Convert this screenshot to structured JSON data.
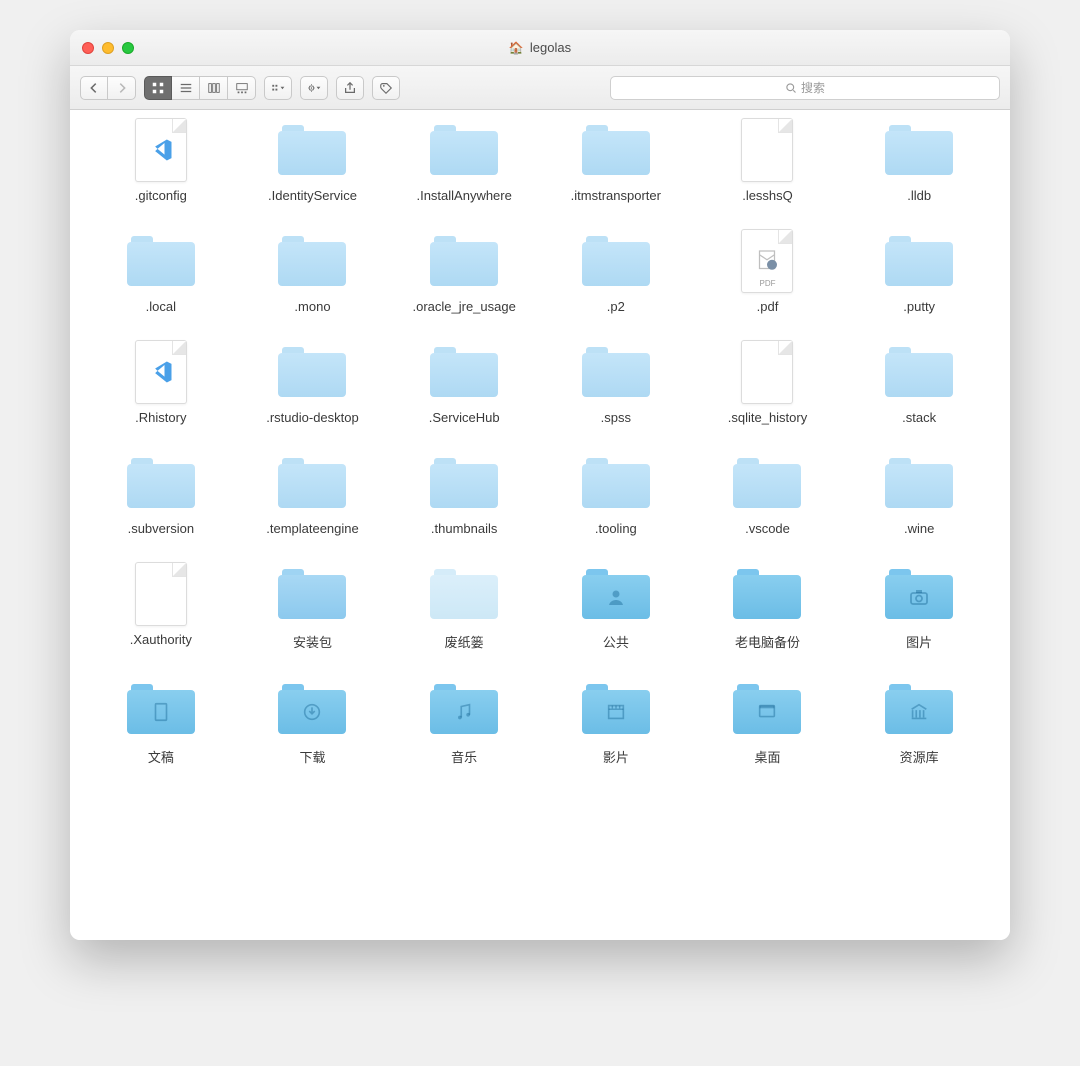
{
  "window": {
    "title": "legolas"
  },
  "search": {
    "placeholder": "搜索"
  },
  "items": [
    {
      "name": ".gitconfig",
      "type": "file",
      "glyph": "vscode"
    },
    {
      "name": ".IdentityService",
      "type": "folder",
      "variant": "light"
    },
    {
      "name": ".InstallAnywhere",
      "type": "folder",
      "variant": "light"
    },
    {
      "name": ".itmstransporter",
      "type": "folder",
      "variant": "light"
    },
    {
      "name": ".lesshsQ",
      "type": "file",
      "glyph": ""
    },
    {
      "name": ".lldb",
      "type": "folder",
      "variant": "light"
    },
    {
      "name": ".local",
      "type": "folder",
      "variant": "light"
    },
    {
      "name": ".mono",
      "type": "folder",
      "variant": "light"
    },
    {
      "name": ".oracle_jre_usage",
      "type": "folder",
      "variant": "light"
    },
    {
      "name": ".p2",
      "type": "folder",
      "variant": "light"
    },
    {
      "name": ".pdf",
      "type": "file",
      "glyph": "pdf",
      "sub": "PDF"
    },
    {
      "name": ".putty",
      "type": "folder",
      "variant": "light"
    },
    {
      "name": ".Rhistory",
      "type": "file",
      "glyph": "vscode"
    },
    {
      "name": ".rstudio-desktop",
      "type": "folder",
      "variant": "light"
    },
    {
      "name": ".ServiceHub",
      "type": "folder",
      "variant": "light"
    },
    {
      "name": ".spss",
      "type": "folder",
      "variant": "light"
    },
    {
      "name": ".sqlite_history",
      "type": "file",
      "glyph": ""
    },
    {
      "name": ".stack",
      "type": "folder",
      "variant": "light"
    },
    {
      "name": ".subversion",
      "type": "folder",
      "variant": "light"
    },
    {
      "name": ".templateengine",
      "type": "folder",
      "variant": "light"
    },
    {
      "name": ".thumbnails",
      "type": "folder",
      "variant": "light"
    },
    {
      "name": ".tooling",
      "type": "folder",
      "variant": "light"
    },
    {
      "name": ".vscode",
      "type": "folder",
      "variant": "light"
    },
    {
      "name": ".wine",
      "type": "folder",
      "variant": "light"
    },
    {
      "name": ".Xauthority",
      "type": "file",
      "glyph": ""
    },
    {
      "name": "安装包",
      "type": "folder",
      "variant": "mid"
    },
    {
      "name": "废纸篓",
      "type": "folder",
      "variant": "faint"
    },
    {
      "name": "公共",
      "type": "folder",
      "variant": "dark",
      "glyph": "person"
    },
    {
      "name": "老电脑备份",
      "type": "folder",
      "variant": "dark"
    },
    {
      "name": "图片",
      "type": "folder",
      "variant": "dark",
      "glyph": "camera"
    },
    {
      "name": "文稿",
      "type": "folder",
      "variant": "dark",
      "glyph": "doc"
    },
    {
      "name": "下载",
      "type": "folder",
      "variant": "dark",
      "glyph": "download"
    },
    {
      "name": "音乐",
      "type": "folder",
      "variant": "dark",
      "glyph": "music"
    },
    {
      "name": "影片",
      "type": "folder",
      "variant": "dark",
      "glyph": "movie"
    },
    {
      "name": "桌面",
      "type": "folder",
      "variant": "dark",
      "glyph": "desktop"
    },
    {
      "name": "资源库",
      "type": "folder",
      "variant": "dark",
      "glyph": "library"
    }
  ]
}
